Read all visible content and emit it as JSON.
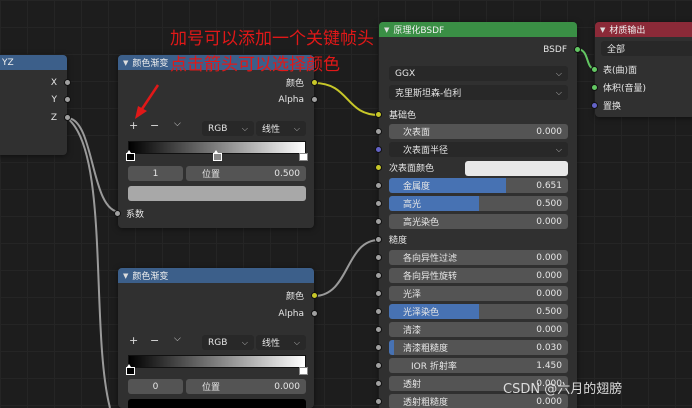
{
  "annotation": {
    "line1": "加号可以添加一个关键帧头",
    "line2": "点击箭头可以选择颜色"
  },
  "watermark": "CSDN @六月的翅膀",
  "xyz_node": {
    "title": "YZ",
    "outputs": [
      "X",
      "Y",
      "Z"
    ]
  },
  "ramp1": {
    "title": "颜色渐变",
    "out_color": "颜色",
    "out_alpha": "Alpha",
    "add_icon": "+",
    "remove_icon": "−",
    "color_mode": "RGB",
    "interpolation": "线性",
    "stop_index": "1",
    "position_label": "位置",
    "position_value": "0.500",
    "input_label": "系数"
  },
  "ramp2": {
    "title": "颜色渐变",
    "out_color": "颜色",
    "out_alpha": "Alpha",
    "color_mode": "RGB",
    "interpolation": "线性",
    "stop_index": "0",
    "position_label": "位置",
    "position_value": "0.000"
  },
  "bsdf": {
    "title": "原理化BSDF",
    "output": "BSDF",
    "distribution": "GGX",
    "subsurface_method": "克里斯坦森-伯利",
    "base_color_label": "基础色",
    "subsurface": {
      "label": "次表面",
      "value": "0.000"
    },
    "subsurface_radius": "次表面半径",
    "subsurface_color": "次表面颜色",
    "metallic": {
      "label": "金属度",
      "value": "0.651",
      "fill": 0.651
    },
    "specular": {
      "label": "高光",
      "value": "0.500",
      "fill": 0.5
    },
    "specular_tint": {
      "label": "高光染色",
      "value": "0.000"
    },
    "roughness_label": "糙度",
    "anisotropic": {
      "label": "各向异性过滤",
      "value": "0.000"
    },
    "anisotropic_rotation": {
      "label": "各向异性旋转",
      "value": "0.000"
    },
    "sheen": {
      "label": "光泽",
      "value": "0.000"
    },
    "sheen_tint": {
      "label": "光泽染色",
      "value": "0.500",
      "fill": 0.5
    },
    "clearcoat": {
      "label": "清漆",
      "value": "0.000"
    },
    "clearcoat_roughness": {
      "label": "清漆粗糙度",
      "value": "0.030"
    },
    "ior": {
      "label": "IOR 折射率",
      "value": "1.450"
    },
    "transmission": {
      "label": "透射",
      "value": "0.000"
    },
    "transmission_roughness": {
      "label": "透射粗糙度",
      "value": "0.000"
    }
  },
  "output_node": {
    "title": "材质输出",
    "target": "全部",
    "inputs": [
      "表(曲)面",
      "体积(音量)",
      "置换"
    ]
  },
  "colors": {
    "node_bg": "#303030",
    "header_blue": "#3c5f8a",
    "header_green": "#3a8f45",
    "header_red": "#8b2a38",
    "slider_fill": "#4772b3",
    "annotation": "#e01818"
  }
}
